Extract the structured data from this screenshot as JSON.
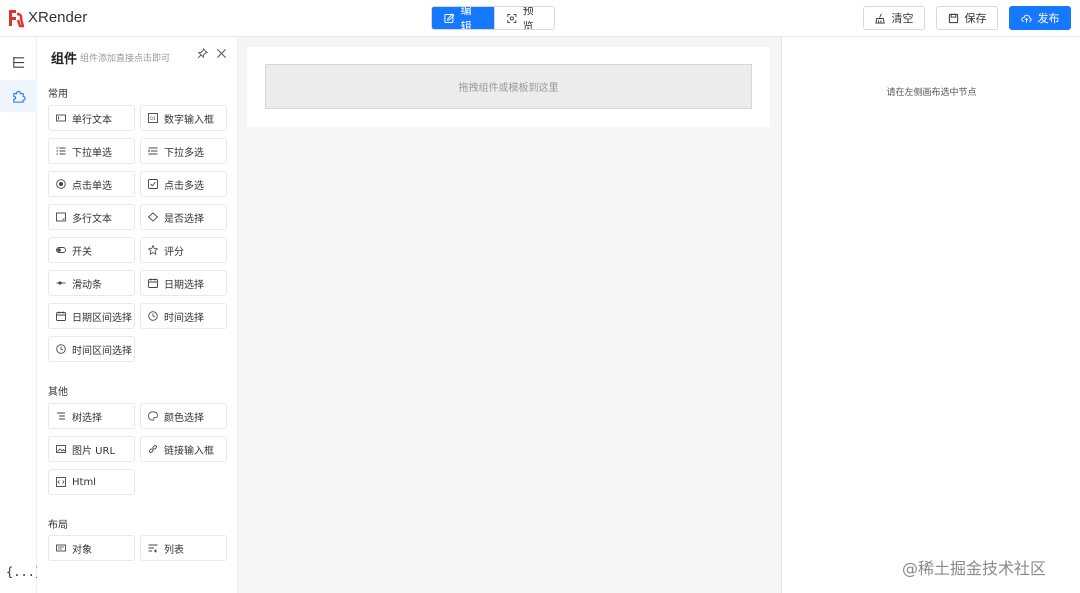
{
  "header": {
    "brand": "XRender",
    "modes": {
      "edit": "编辑",
      "preview": "预览"
    },
    "clear": "清空",
    "save": "保存",
    "publish": "发布"
  },
  "panel": {
    "title": "组件",
    "hint": "组件添加直接点击即可",
    "sections": {
      "common": "常用",
      "other": "其他",
      "layout": "布局"
    },
    "common_items": [
      "单行文本",
      "数字输入框",
      "下拉单选",
      "下拉多选",
      "点击单选",
      "点击多选",
      "多行文本",
      "是否选择",
      "开关",
      "评分",
      "滑动条",
      "日期选择",
      "日期区间选择",
      "时间选择",
      "时间区间选择"
    ],
    "other_items": [
      "树选择",
      "颜色选择",
      "图片 URL",
      "链接输入框",
      "Html"
    ],
    "layout_items": [
      "对象",
      "列表"
    ]
  },
  "canvas": {
    "drop_hint": "拖拽组件或模板到这里"
  },
  "right_panel": {
    "hint": "请在左侧画布选中节点"
  },
  "iconbar": {
    "code_label": "{...}"
  },
  "watermark": "@稀土掘金技术社区",
  "colors": {
    "primary": "#1677ff",
    "logo": "#e0342f",
    "canvas_bg": "#f5f5f5"
  }
}
